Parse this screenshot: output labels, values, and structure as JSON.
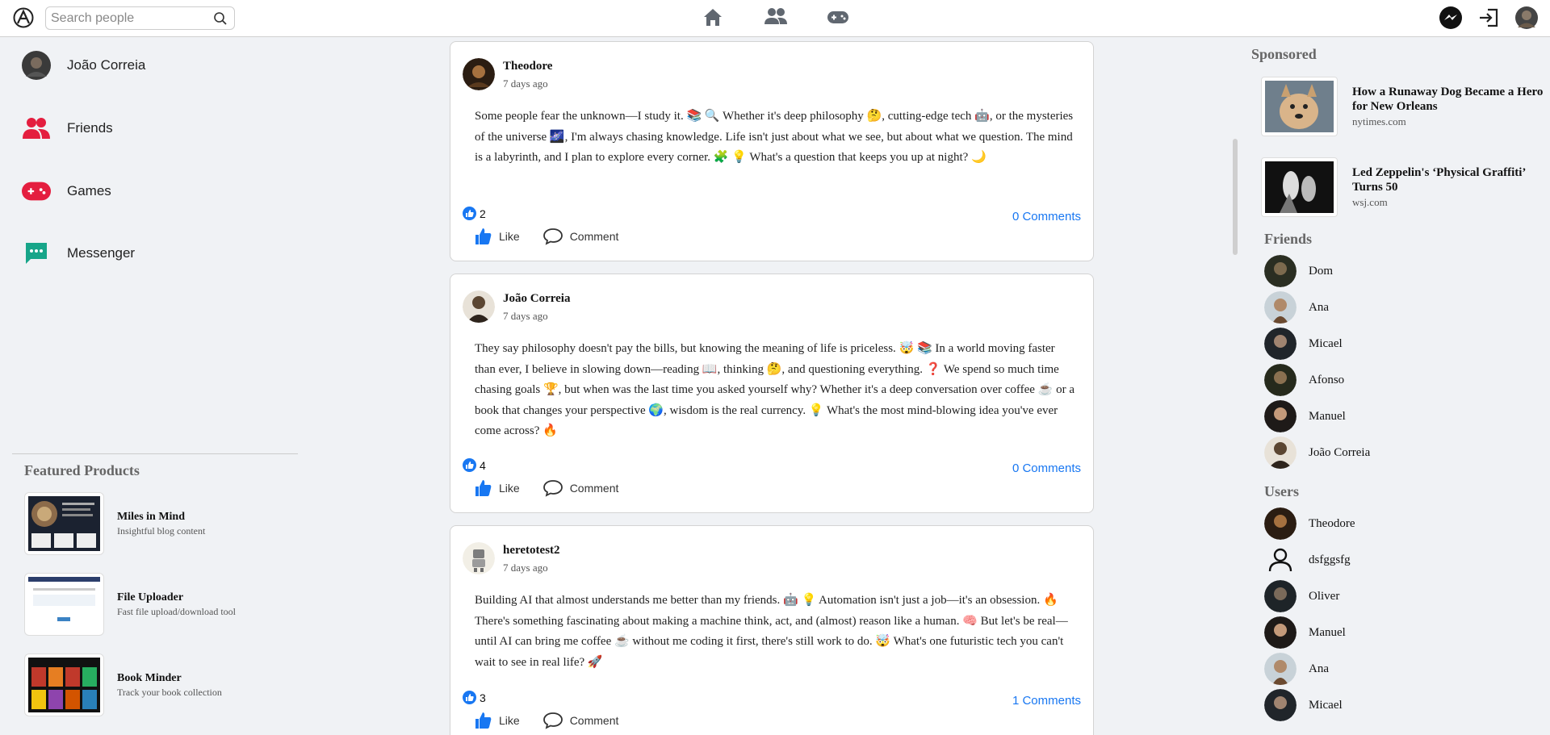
{
  "search": {
    "placeholder": "Search people"
  },
  "left_nav": [
    {
      "label": "João Correia",
      "icon": "profile-avatar"
    },
    {
      "label": "Friends",
      "icon": "friends-icon"
    },
    {
      "label": "Games",
      "icon": "gamepad-icon"
    },
    {
      "label": "Messenger",
      "icon": "chat-icon"
    }
  ],
  "featured": {
    "title": "Featured Products",
    "items": [
      {
        "name": "Miles in Mind",
        "desc": "Insightful blog content"
      },
      {
        "name": "File Uploader",
        "desc": "Fast file upload/download tool"
      },
      {
        "name": "Book Minder",
        "desc": "Track your book collection"
      }
    ]
  },
  "posts": [
    {
      "author": "Theodore",
      "time": "7 days ago",
      "text": "Some people fear the unknown—I study it. 📚 🔍 Whether it's deep philosophy 🤔, cutting-edge tech 🤖, or the mysteries of the universe 🌌, I'm always chasing knowledge. Life isn't just about what we see, but about what we question. The mind is a labyrinth, and I plan to explore every corner. 🧩 💡 What's a question that keeps you up at night? 🌙",
      "likes": "2",
      "comments": "0 Comments",
      "like_label": "Like",
      "comment_label": "Comment"
    },
    {
      "author": "João Correia",
      "time": "7 days ago",
      "text": "They say philosophy doesn't pay the bills, but knowing the meaning of life is priceless. 🤯 📚 In a world moving faster than ever, I believe in slowing down—reading 📖, thinking 🤔, and questioning everything. ❓ We spend so much time chasing goals 🏆, but when was the last time you asked yourself why? Whether it's a deep conversation over coffee ☕ or a book that changes your perspective 🌍, wisdom is the real currency. 💡 What's the most mind-blowing idea you've ever come across? 🔥",
      "likes": "4",
      "comments": "0 Comments",
      "like_label": "Like",
      "comment_label": "Comment"
    },
    {
      "author": "heretotest2",
      "time": "7 days ago",
      "text": "Building AI that almost understands me better than my friends. 🤖 💡 Automation isn't just a job—it's an obsession. 🔥 There's something fascinating about making a machine think, act, and (almost) reason like a human. 🧠 But let's be real—until AI can bring me coffee ☕ without me coding it first, there's still work to do. 🤯 What's one futuristic tech you can't wait to see in real life? 🚀",
      "likes": "3",
      "comments": "1 Comments",
      "like_label": "Like",
      "comment_label": "Comment"
    }
  ],
  "sponsored": {
    "title": "Sponsored",
    "items": [
      {
        "title": "How a Runaway Dog Became a Hero for New Orleans",
        "source": "nytimes.com"
      },
      {
        "title": "Led Zeppelin's ‘Physical Graffiti’ Turns 50",
        "source": "wsj.com"
      }
    ]
  },
  "friends": {
    "title": "Friends",
    "items": [
      "Dom",
      "Ana",
      "Micael",
      "Afonso",
      "Manuel",
      "João Correia"
    ]
  },
  "users": {
    "title": "Users",
    "items": [
      "Theodore",
      "dsfggsfg",
      "Oliver",
      "Manuel",
      "Ana",
      "Micael"
    ]
  },
  "colors": {
    "accent": "#1877f2",
    "games": "#e41e3f",
    "messenger": "#17a589",
    "friends": "#e41e3f"
  }
}
